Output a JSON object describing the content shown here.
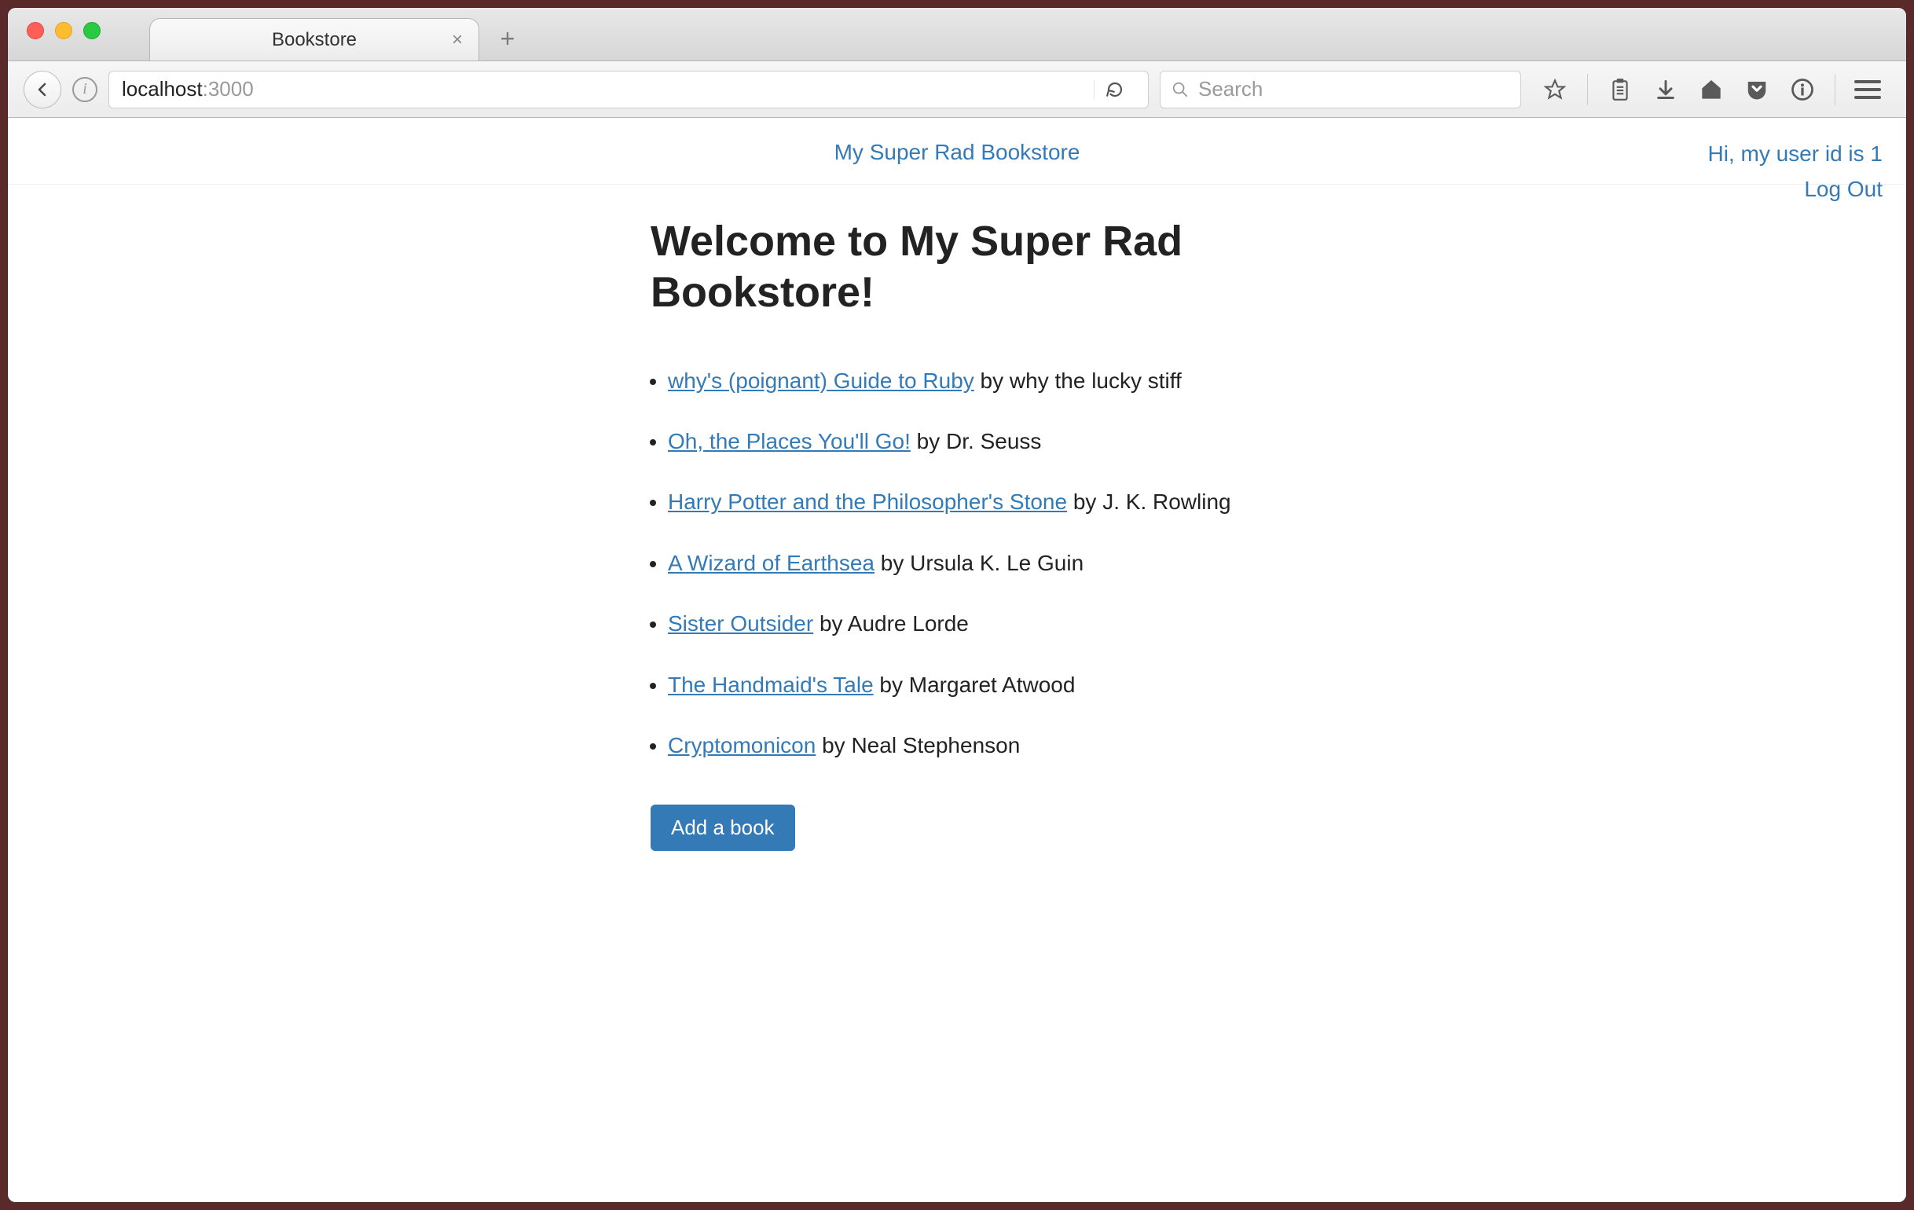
{
  "browser": {
    "tab_title": "Bookstore",
    "url_host": "localhost",
    "url_port": ":3000",
    "search_placeholder": "Search"
  },
  "nav": {
    "brand": "My Super Rad Bookstore",
    "greeting": "Hi, my user id is 1",
    "logout": "Log Out"
  },
  "page": {
    "heading": "Welcome to My Super Rad Bookstore!",
    "by_word": " by ",
    "add_button": "Add a book"
  },
  "books": [
    {
      "title": "why's (poignant) Guide to Ruby",
      "author": "why the lucky stiff"
    },
    {
      "title": "Oh, the Places You'll Go!",
      "author": "Dr. Seuss"
    },
    {
      "title": "Harry Potter and the Philosopher's Stone",
      "author": "J. K. Rowling"
    },
    {
      "title": "A Wizard of Earthsea",
      "author": "Ursula K. Le Guin"
    },
    {
      "title": "Sister Outsider",
      "author": "Audre Lorde"
    },
    {
      "title": "The Handmaid's Tale",
      "author": "Margaret Atwood"
    },
    {
      "title": "Cryptomonicon",
      "author": "Neal Stephenson"
    }
  ]
}
